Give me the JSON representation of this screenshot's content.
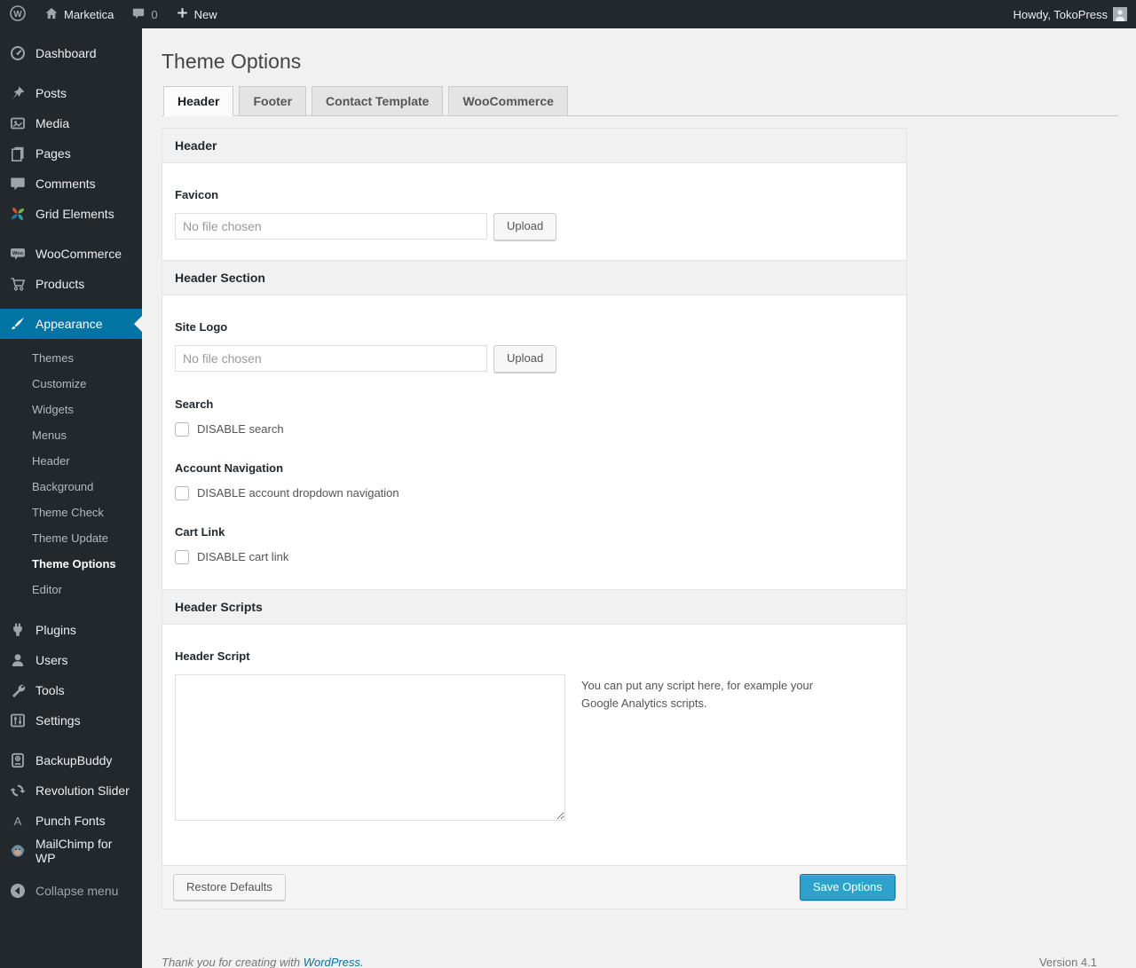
{
  "admin_bar": {
    "site_name": "Marketica",
    "comment_count": "0",
    "new_label": "New",
    "howdy": "Howdy, TokoPress"
  },
  "sidebar": {
    "items": [
      {
        "label": "Dashboard",
        "icon": "dashboard-icon"
      },
      {
        "label": "Posts",
        "icon": "pushpin-icon"
      },
      {
        "label": "Media",
        "icon": "media-icon"
      },
      {
        "label": "Pages",
        "icon": "pages-icon"
      },
      {
        "label": "Comments",
        "icon": "comment-bubble-icon"
      },
      {
        "label": "Grid Elements",
        "icon": "grid-elements-icon"
      },
      {
        "label": "WooCommerce",
        "icon": "woocommerce-badge-icon"
      },
      {
        "label": "Products",
        "icon": "cart-icon"
      },
      {
        "label": "Appearance",
        "icon": "paintbrush-icon",
        "active": true
      },
      {
        "label": "Plugins",
        "icon": "plug-icon"
      },
      {
        "label": "Users",
        "icon": "user-icon"
      },
      {
        "label": "Tools",
        "icon": "wrench-icon"
      },
      {
        "label": "Settings",
        "icon": "sliders-icon"
      },
      {
        "label": "BackupBuddy",
        "icon": "drive-icon"
      },
      {
        "label": "Revolution Slider",
        "icon": "rotate-arrows-icon"
      },
      {
        "label": "Punch Fonts",
        "icon": "letter-a-icon"
      },
      {
        "label": "MailChimp for WP",
        "icon": "monkey-icon"
      },
      {
        "label": "Collapse menu",
        "icon": "collapse-arrow-icon"
      }
    ],
    "appearance_submenu": [
      "Themes",
      "Customize",
      "Widgets",
      "Menus",
      "Header",
      "Background",
      "Theme Check",
      "Theme Update",
      "Theme Options",
      "Editor"
    ],
    "current_submenu": "Theme Options"
  },
  "page": {
    "title": "Theme Options",
    "tabs": [
      {
        "label": "Header",
        "active": true
      },
      {
        "label": "Footer",
        "active": false
      },
      {
        "label": "Contact Template",
        "active": false
      },
      {
        "label": "WooCommerce",
        "active": false
      }
    ]
  },
  "form": {
    "section_titles": [
      "Header",
      "Header Section",
      "Header Scripts"
    ],
    "favicon": {
      "label": "Favicon",
      "placeholder": "No file chosen",
      "value": "",
      "upload_label": "Upload"
    },
    "site_logo": {
      "label": "Site Logo",
      "placeholder": "No file chosen",
      "value": "",
      "upload_label": "Upload"
    },
    "search": {
      "label": "Search",
      "checkbox_label": "DISABLE search",
      "checked": false
    },
    "account_nav": {
      "label": "Account Navigation",
      "checkbox_label": "DISABLE account dropdown navigation",
      "checked": false
    },
    "cart_link": {
      "label": "Cart Link",
      "checkbox_label": "DISABLE cart link",
      "checked": false
    },
    "header_script": {
      "label": "Header Script",
      "value": "",
      "description": "You can put any script here, for example your Google Analytics scripts."
    },
    "restore_label": "Restore Defaults",
    "save_label": "Save Options"
  },
  "footer": {
    "thanks_prefix": "Thank you for creating with ",
    "wordpress_link": "WordPress.",
    "version": "Version 4.1"
  },
  "icons": {
    "wp_logo_text": "W",
    "woo_badge_text": "Woo",
    "punch_fonts_text": "A"
  },
  "colors": {
    "accent_blue": "#0074a2",
    "primary_button": "#2ea2cc",
    "admin_dark": "#23282d",
    "page_background": "#f1f1f1"
  }
}
